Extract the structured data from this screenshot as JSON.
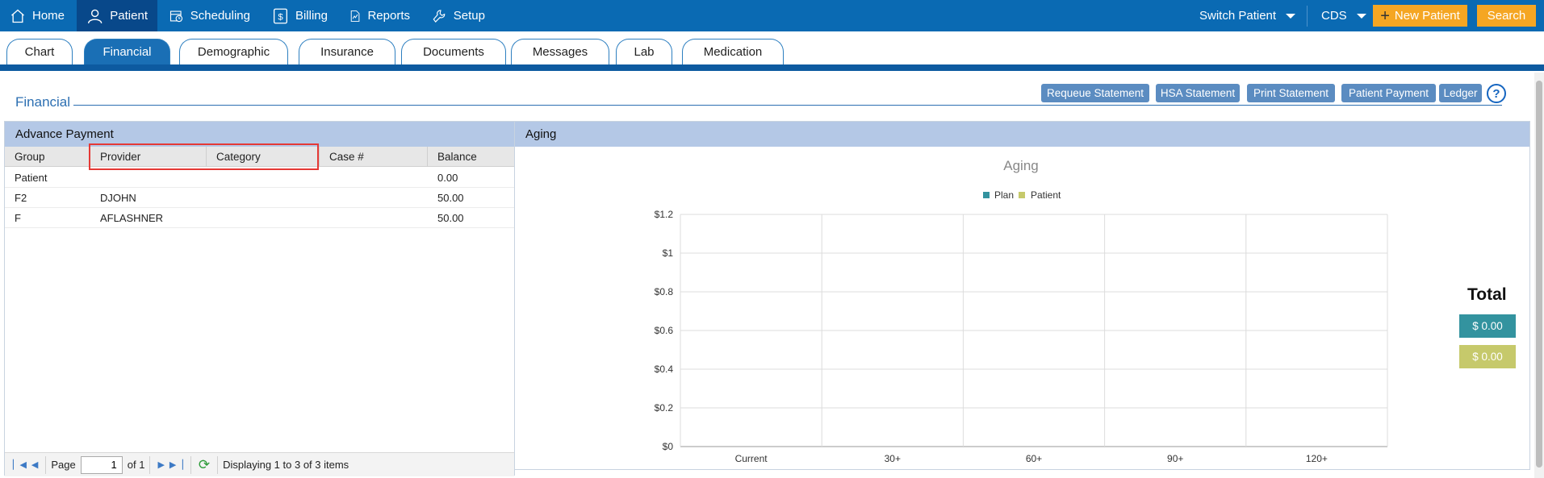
{
  "topnav": {
    "items": [
      {
        "label": "Home",
        "icon": "home-icon"
      },
      {
        "label": "Patient",
        "icon": "person-icon",
        "active": true
      },
      {
        "label": "Scheduling",
        "icon": "calendar-clock-icon"
      },
      {
        "label": "Billing",
        "icon": "dollar-icon"
      },
      {
        "label": "Reports",
        "icon": "report-chart-icon"
      },
      {
        "label": "Setup",
        "icon": "wrench-icon"
      }
    ],
    "switch_patient": "Switch Patient",
    "cds": "CDS",
    "new_patient": "New Patient",
    "search": "Search"
  },
  "tabs": [
    "Chart",
    "Financial",
    "Demographic",
    "Insurance",
    "Documents",
    "Messages",
    "Lab",
    "Medication"
  ],
  "active_tab": "Financial",
  "page_title": "Financial",
  "actions": [
    "Requeue Statement",
    "HSA Statement",
    "Print Statement",
    "Patient Payment",
    "Ledger"
  ],
  "help": "?",
  "advance_payment": {
    "title": "Advance Payment",
    "columns": [
      "Group",
      "Provider",
      "Category",
      "Case #",
      "Balance"
    ],
    "rows": [
      [
        "Patient",
        "",
        "",
        "",
        "0.00"
      ],
      [
        "F2",
        "DJOHN",
        "",
        "",
        "50.00"
      ],
      [
        "F",
        "AFLASHNER",
        "",
        "",
        "50.00"
      ]
    ],
    "pager": {
      "page_label": "Page",
      "page_value": "1",
      "of_label": "of 1",
      "display_text": "Displaying 1 to 3 of 3 items"
    }
  },
  "aging": {
    "panel_title": "Aging",
    "total_label": "Total",
    "plan_total": "$ 0.00",
    "patient_total": "$ 0.00"
  },
  "colors": {
    "plan": "#33939f",
    "patient": "#c6c96b",
    "brand": "#0a6ab3",
    "accent": "#f5a623"
  },
  "chart_data": {
    "type": "bar",
    "title": "Aging",
    "categories": [
      "Current",
      "30+",
      "60+",
      "90+",
      "120+"
    ],
    "series": [
      {
        "name": "Plan",
        "values": [
          0,
          0,
          0,
          0,
          0
        ]
      },
      {
        "name": "Patient",
        "values": [
          0,
          0,
          0,
          0,
          0
        ]
      }
    ],
    "yticks": [
      "$0",
      "$0.2",
      "$0.4",
      "$0.6",
      "$0.8",
      "$1",
      "$1.2"
    ],
    "ylim": [
      0,
      1.2
    ],
    "grid": true,
    "legend": "top"
  }
}
